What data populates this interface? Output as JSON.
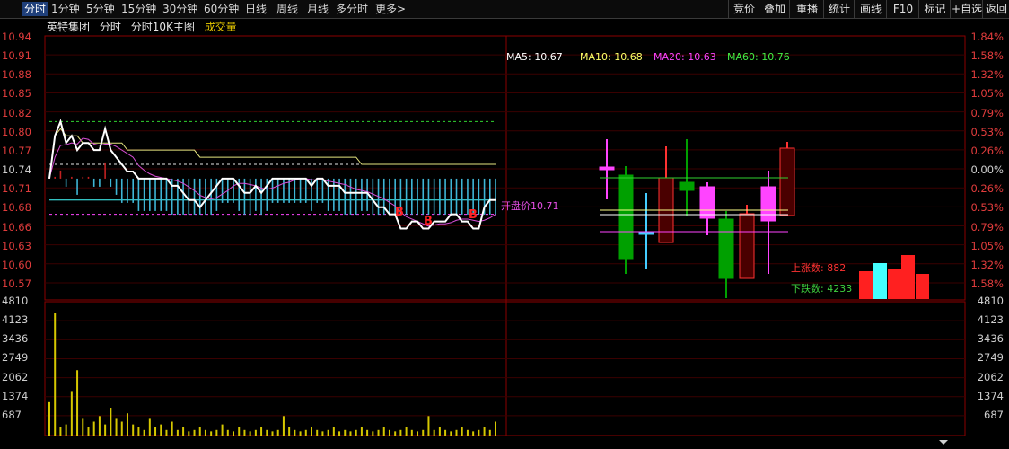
{
  "toolbar": {
    "tabs": [
      "分时",
      "1分钟",
      "5分钟",
      "15分钟",
      "30分钟",
      "60分钟",
      "日线",
      "周线",
      "月线",
      "多分时",
      "更多>"
    ],
    "right_buttons": [
      "竞价",
      "叠加",
      "重播",
      "统计",
      "画线",
      "F10",
      "+自选",
      "返回"
    ],
    "mark_label": "标记"
  },
  "header": {
    "stock_name": "英特集团",
    "items": [
      "分时",
      "分时10K主图"
    ],
    "volume_label": "成交量"
  },
  "price_axis": {
    "left": [
      "10.94",
      "10.91",
      "10.88",
      "10.85",
      "10.82",
      "10.80",
      "10.77",
      "10.74",
      "10.71",
      "10.68",
      "10.66",
      "10.63",
      "10.60",
      "10.57"
    ],
    "right": [
      "1.84%",
      "1.58%",
      "1.32%",
      "1.05%",
      "0.79%",
      "0.53%",
      "0.26%",
      "0.00%",
      "0.26%",
      "0.53%",
      "0.79%",
      "1.05%",
      "1.32%",
      "1.58%"
    ]
  },
  "volume_axis": {
    "left": [
      "4810",
      "4123",
      "3436",
      "2749",
      "2062",
      "1374",
      "687"
    ],
    "right": [
      "4810",
      "4123",
      "3436",
      "2749",
      "2062",
      "1374",
      "687"
    ]
  },
  "ma_legend": [
    {
      "label": "MA5: 10.67",
      "color": "#ffffff"
    },
    {
      "label": "MA10: 10.68",
      "color": "#ffff66"
    },
    {
      "label": "MA20: 10.63",
      "color": "#ff44ff"
    },
    {
      "label": "MA60: 10.76",
      "color": "#44ee44"
    }
  ],
  "open_price_label": "开盘价10.71",
  "signal_labels": [
    "B",
    "B",
    "B"
  ],
  "breadth": {
    "up_label": "上涨数: 882",
    "down_label": "下跌数: 4233"
  },
  "colors": {
    "up": "#ff3232",
    "down": "#00a000",
    "cyan": "#54ffff",
    "grid": "#8b0000",
    "price_line": "#ffffff",
    "avg_line": "#e6e680"
  },
  "chart_data": [
    {
      "type": "line",
      "title": "分时",
      "ylim": [
        10.57,
        10.94
      ],
      "reference_price": 10.74,
      "open_price": 10.71,
      "series": [
        {
          "name": "price",
          "values": [
            10.74,
            10.8,
            10.82,
            10.79,
            10.8,
            10.78,
            10.79,
            10.79,
            10.78,
            10.78,
            10.81,
            10.78,
            10.77,
            10.76,
            10.75,
            10.75,
            10.74,
            10.74,
            10.74,
            10.74,
            10.74,
            10.74,
            10.73,
            10.73,
            10.72,
            10.71,
            10.71,
            10.7,
            10.71,
            10.72,
            10.73,
            10.74,
            10.74,
            10.74,
            10.73,
            10.72,
            10.72,
            10.73,
            10.72,
            10.73,
            10.74,
            10.74,
            10.74,
            10.74,
            10.74,
            10.74,
            10.74,
            10.73,
            10.74,
            10.74,
            10.73,
            10.73,
            10.73,
            10.72,
            10.72,
            10.72,
            10.72,
            10.72,
            10.71,
            10.7,
            10.7,
            10.69,
            10.69,
            10.67,
            10.67,
            10.68,
            10.68,
            10.67,
            10.67,
            10.68,
            10.68,
            10.68,
            10.69,
            10.69,
            10.68,
            10.68,
            10.67,
            10.67,
            10.7,
            10.71,
            10.71
          ]
        },
        {
          "name": "avg",
          "values": [
            10.74,
            10.8,
            10.81,
            10.8,
            10.8,
            10.8,
            10.79,
            10.79,
            10.79,
            10.79,
            10.79,
            10.79,
            10.79,
            10.79,
            10.78,
            10.78,
            10.78,
            10.78,
            10.78,
            10.78,
            10.78,
            10.78,
            10.78,
            10.78,
            10.78,
            10.78,
            10.78,
            10.77,
            10.77,
            10.77,
            10.77,
            10.77,
            10.77,
            10.77,
            10.77,
            10.77,
            10.77,
            10.77,
            10.77,
            10.77,
            10.77,
            10.77,
            10.77,
            10.77,
            10.77,
            10.77,
            10.77,
            10.77,
            10.77,
            10.77,
            10.77,
            10.77,
            10.77,
            10.77,
            10.77,
            10.77,
            10.76,
            10.76,
            10.76,
            10.76,
            10.76,
            10.76,
            10.76,
            10.76,
            10.76,
            10.76,
            10.76,
            10.76,
            10.76,
            10.76,
            10.76,
            10.76,
            10.76,
            10.76,
            10.76,
            10.76,
            10.76,
            10.76,
            10.76,
            10.76,
            10.76
          ]
        }
      ]
    },
    {
      "type": "bar",
      "title": "成交量",
      "ylim": [
        0,
        4810
      ],
      "values": [
        1200,
        4420,
        300,
        400,
        1600,
        2350,
        600,
        300,
        500,
        700,
        400,
        1000,
        600,
        500,
        800,
        400,
        300,
        200,
        600,
        300,
        400,
        200,
        500,
        200,
        300,
        150,
        200,
        300,
        200,
        150,
        200,
        400,
        200,
        150,
        300,
        200,
        150,
        200,
        300,
        200,
        150,
        200,
        700,
        300,
        200,
        150,
        200,
        300,
        200,
        150,
        200,
        300,
        150,
        200,
        150,
        200,
        300,
        200,
        150,
        200,
        300,
        200,
        150,
        200,
        300,
        200,
        150,
        200,
        700,
        200,
        300,
        200,
        150,
        200,
        300,
        200,
        150,
        200,
        300,
        200,
        500
      ]
    }
  ]
}
